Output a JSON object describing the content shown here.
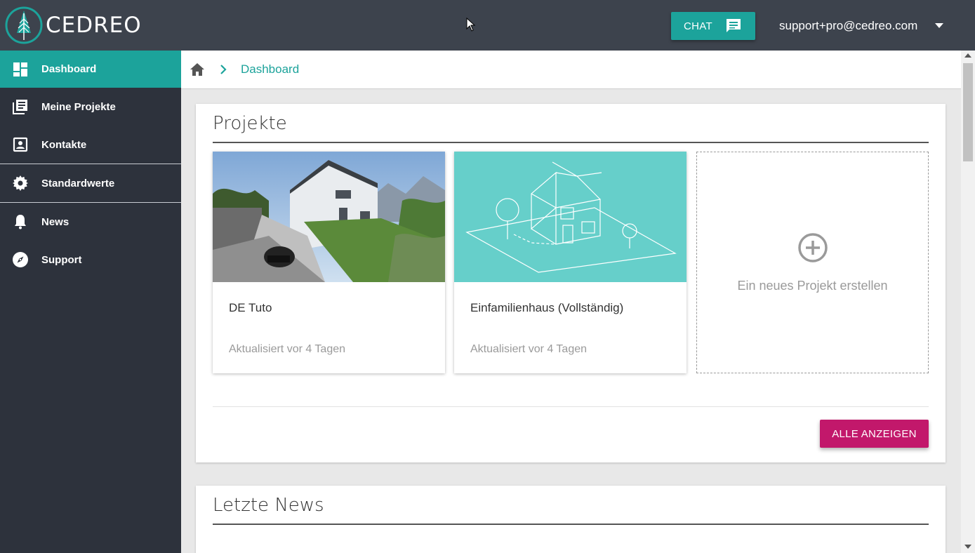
{
  "brand": {
    "name": "CEDREO",
    "accent": "#1ca39b",
    "primary_button": "#c2186b",
    "topbar_bg": "#3d434d",
    "sidebar_bg": "#2d323c"
  },
  "header": {
    "chat_label": "CHAT",
    "user_email": "support+pro@cedreo.com"
  },
  "sidebar": {
    "items": [
      {
        "label": "Dashboard",
        "icon": "dashboard-icon"
      },
      {
        "label": "Meine Projekte",
        "icon": "projects-icon"
      },
      {
        "label": "Kontakte",
        "icon": "contacts-icon"
      },
      {
        "label": "Standardwerte",
        "icon": "gear-icon"
      },
      {
        "label": "News",
        "icon": "bell-icon"
      },
      {
        "label": "Support",
        "icon": "compass-icon"
      }
    ]
  },
  "breadcrumb": {
    "current": "Dashboard"
  },
  "projects": {
    "title": "Projekte",
    "cards": [
      {
        "title": "DE Tuto",
        "date": "Aktualisiert vor 4 Tagen"
      },
      {
        "title": "Einfamilienhaus (Vollständig)",
        "date": "Aktualisiert vor 4 Tagen"
      }
    ],
    "new_project_label": "Ein neues Projekt erstellen",
    "show_all_label": "ALLE ANZEIGEN"
  },
  "news": {
    "title": "Letzte News"
  }
}
